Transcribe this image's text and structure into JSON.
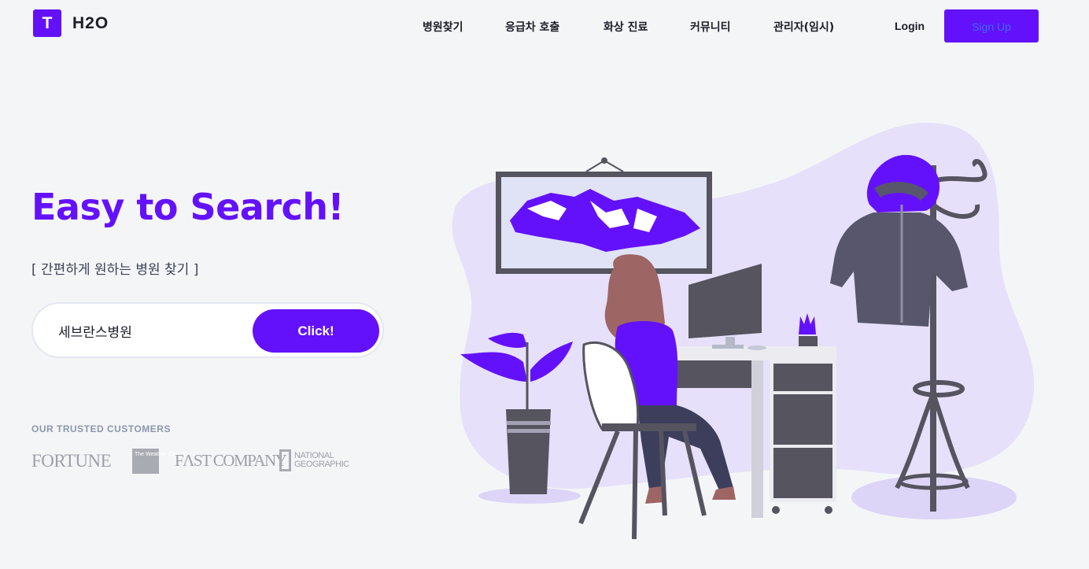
{
  "header": {
    "logo_letter": "T",
    "brand": "H2O",
    "nav": [
      "병원찾기",
      "응급차 호출",
      "화상 진료",
      "커뮤니티",
      "관리자(임시)"
    ],
    "login": "Login",
    "signup": "Sign Up"
  },
  "hero": {
    "headline": "Easy to Search!",
    "subline": "[ 간편하게 원하는 병원 찾기 ]",
    "search_value": "세브란스병원",
    "search_button": "Click!"
  },
  "customers": {
    "title": "OUR TRUSTED CUSTOMERS",
    "logos": [
      "FORTUNE",
      "The Weather Channel",
      "FASTCOMPANY",
      "NATIONAL GEOGRAPHIC"
    ],
    "fortune": "FORTUNE",
    "weather": "The Weather Channel",
    "fast": "FΛST COMPANY",
    "natgeo_1": "NATIONAL",
    "natgeo_2": "GEOGRAPHIC"
  },
  "colors": {
    "accent": "#6411fb",
    "background": "#f4f5f7",
    "blob": "#e6e0fa",
    "dark_gray": "#55545f"
  }
}
